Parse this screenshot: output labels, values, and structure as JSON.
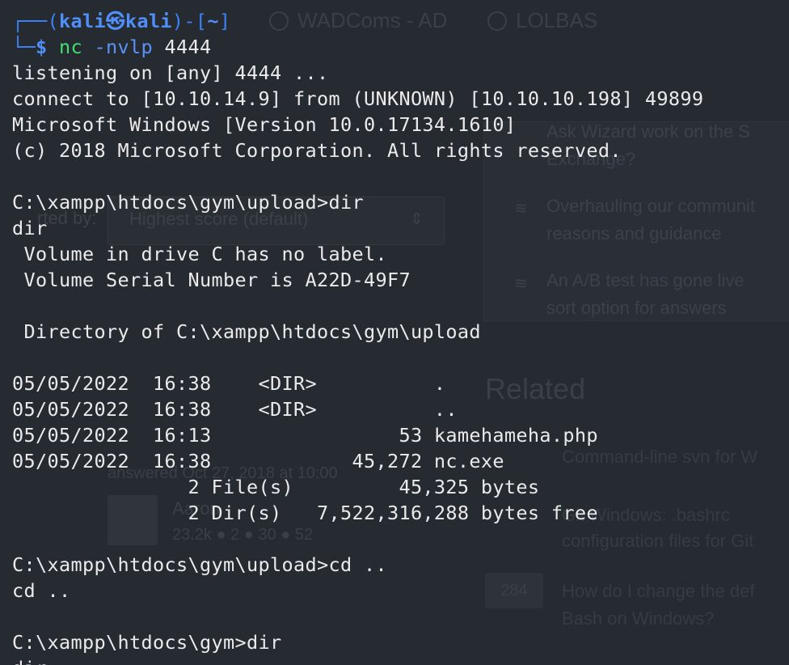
{
  "background": {
    "bookmarks": [
      "WADComs - AD",
      "LOLBAS"
    ],
    "side_links": [
      "Ask Wizard work on the S",
      "Exchange?",
      "Overhauling our communit",
      "reasons and guidance",
      "An A/B test has gone live",
      "sort option for answers"
    ],
    "sort": {
      "label": "rted by:",
      "value": "Highest score (default)"
    },
    "related_title": "Related",
    "related_links": [
      "Command-line svn for W",
      "Git Windows: .bashrc",
      "configuration files for Git",
      "How do I change the def",
      "Bash on Windows?"
    ],
    "related_badge": "284",
    "answered": "answered Oct 27, 2018 at 10:00",
    "user_name": "Aaron",
    "user_rep": "23.2k ● 2 ● 30 ● 52"
  },
  "terminal": {
    "prompt": {
      "frame_open": "┌──(",
      "user": "kali",
      "at": "㉿",
      "host": "kali",
      "frame_mid": ")-[",
      "path": "~",
      "frame_close": "]",
      "frame_bottom": "└─",
      "symbol": "$",
      "command": "nc",
      "flags": "-nvlp",
      "port": "4444"
    },
    "lines": [
      "listening on [any] 4444 ...",
      "connect to [10.10.14.9] from (UNKNOWN) [10.10.10.198] 49899",
      "Microsoft Windows [Version 10.0.17134.1610]",
      "(c) 2018 Microsoft Corporation. All rights reserved.",
      "",
      "C:\\xampp\\htdocs\\gym\\upload>dir",
      "dir",
      " Volume in drive C has no label.",
      " Volume Serial Number is A22D-49F7",
      "",
      " Directory of C:\\xampp\\htdocs\\gym\\upload",
      "",
      "05/05/2022  16:38    <DIR>          .",
      "05/05/2022  16:38    <DIR>          ..",
      "05/05/2022  16:13                53 kamehameha.php",
      "05/05/2022  16:38            45,272 nc.exe",
      "               2 File(s)         45,325 bytes",
      "               2 Dir(s)   7,522,316,288 bytes free",
      "",
      "C:\\xampp\\htdocs\\gym\\upload>cd ..",
      "cd ..",
      "",
      "C:\\xampp\\htdocs\\gym>dir",
      "dir"
    ]
  },
  "colors": {
    "background": "#262a31",
    "text": "#ebebeb",
    "prompt_blue": "#4f8ff7",
    "command_green": "#3fe06f"
  }
}
